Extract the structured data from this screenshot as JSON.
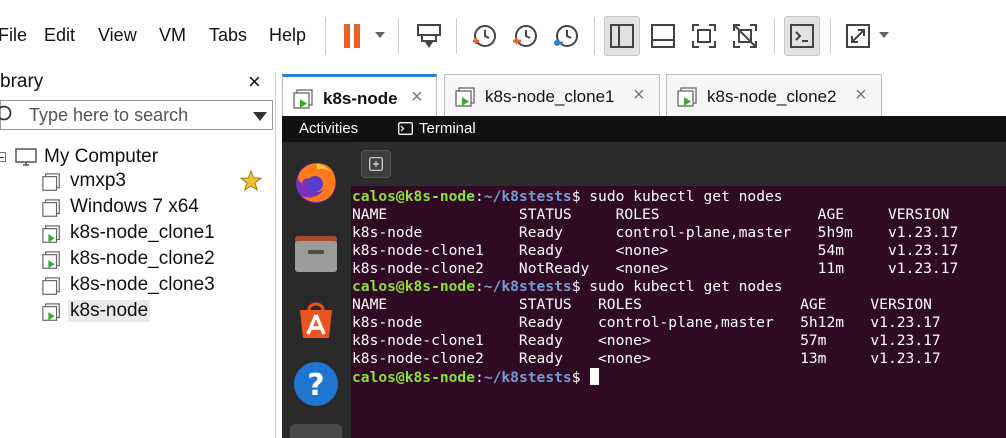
{
  "menubar": {
    "items": [
      "File",
      "Edit",
      "View",
      "VM",
      "Tabs",
      "Help"
    ]
  },
  "toolbar": {
    "buttons": [
      "pause-icon",
      "send-ctrl-alt-del-icon",
      "take-snapshot-icon",
      "revert-snapshot-icon",
      "manage-snapshots-icon",
      "show-library-icon",
      "thumbnail-bar-icon",
      "full-screen-icon",
      "unity-icon",
      "console-view-icon",
      "stretch-guest-icon"
    ],
    "pause_color": "#e8622c"
  },
  "library": {
    "title": "brary",
    "close_label": "×",
    "search_placeholder": "Type here to search",
    "root_label": "My Computer",
    "items": [
      {
        "label": "vmxp3",
        "running": false,
        "favorite": true
      },
      {
        "label": "Windows 7 x64",
        "running": false,
        "favorite": false
      },
      {
        "label": "k8s-node_clone1",
        "running": true,
        "favorite": false
      },
      {
        "label": "k8s-node_clone2",
        "running": true,
        "favorite": false
      },
      {
        "label": "k8s-node_clone3",
        "running": false,
        "favorite": false
      },
      {
        "label": "k8s-node",
        "running": true,
        "favorite": false,
        "selected": true
      }
    ]
  },
  "tabs": [
    {
      "label": "k8s-node",
      "active": true,
      "close": "×"
    },
    {
      "label": "k8s-node_clone1",
      "active": false,
      "close": "×"
    },
    {
      "label": "k8s-node_clone2",
      "active": false,
      "close": "×"
    }
  ],
  "guest": {
    "activities": "Activities",
    "app_name": "Terminal",
    "dock_apps": [
      "firefox-icon",
      "files-icon",
      "app-center-icon",
      "help-icon",
      "show-apps-icon"
    ],
    "prompt_user": "calos@k8s-node",
    "prompt_path": "~/k8stests",
    "lines": [
      {
        "type": "prompt",
        "cmd": " sudo kubectl get nodes"
      },
      {
        "type": "out",
        "text": "NAME               STATUS     ROLES                  AGE     VERSION"
      },
      {
        "type": "out",
        "text": "k8s-node           Ready      control-plane,master   5h9m    v1.23.17"
      },
      {
        "type": "out",
        "text": "k8s-node-clone1    Ready      <none>                 54m     v1.23.17"
      },
      {
        "type": "out",
        "text": "k8s-node-clone2    NotReady   <none>                 11m     v1.23.17"
      },
      {
        "type": "prompt",
        "cmd": " sudo kubectl get nodes"
      },
      {
        "type": "out",
        "text": "NAME               STATUS   ROLES                  AGE     VERSION"
      },
      {
        "type": "out",
        "text": "k8s-node           Ready    control-plane,master   5h12m   v1.23.17"
      },
      {
        "type": "out",
        "text": "k8s-node-clone1    Ready    <none>                 57m     v1.23.17"
      },
      {
        "type": "out",
        "text": "k8s-node-clone2    Ready    <none>                 13m     v1.23.17"
      },
      {
        "type": "prompt",
        "cmd": " ",
        "cursor": true
      }
    ]
  },
  "colors": {
    "terminal_bg": "#300a24",
    "prompt_user": "#8ae234",
    "prompt_path": "#729fcf",
    "running_vm": "#3fa535",
    "tab_accent": "#2f7fd0"
  }
}
